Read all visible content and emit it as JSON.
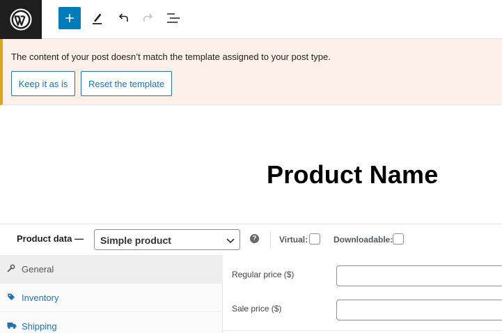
{
  "toolbar": {
    "logo_icon": "wordpress-logo-icon",
    "add_icon": "plus-icon",
    "tools_icon": "pencil-icon",
    "undo_icon": "undo-icon",
    "redo_icon": "redo-icon",
    "outline_icon": "list-view-icon",
    "accent": "#007cba"
  },
  "notice": {
    "message": "The content of your post doesn’t match the template assigned to your post type.",
    "keep_label": "Keep it as is",
    "reset_label": "Reset the template",
    "accent": "#dba617"
  },
  "editor": {
    "title": "Product Name"
  },
  "product_data": {
    "label": "Product data —",
    "type_selected": "Simple product",
    "help_icon": "help-icon",
    "help_glyph": "?",
    "virtual_label": "Virtual:",
    "downloadable_label": "Downloadable:",
    "virtual_checked": false,
    "downloadable_checked": false
  },
  "tabs": [
    {
      "label": "General",
      "icon": "wrench-icon"
    },
    {
      "label": "Inventory",
      "icon": "tag-icon"
    },
    {
      "label": "Shipping",
      "icon": "truck-icon"
    }
  ],
  "fields": {
    "regular_price_label": "Regular price ($)",
    "regular_price_value": "",
    "sale_price_label": "Sale price ($)",
    "sale_price_value": ""
  }
}
